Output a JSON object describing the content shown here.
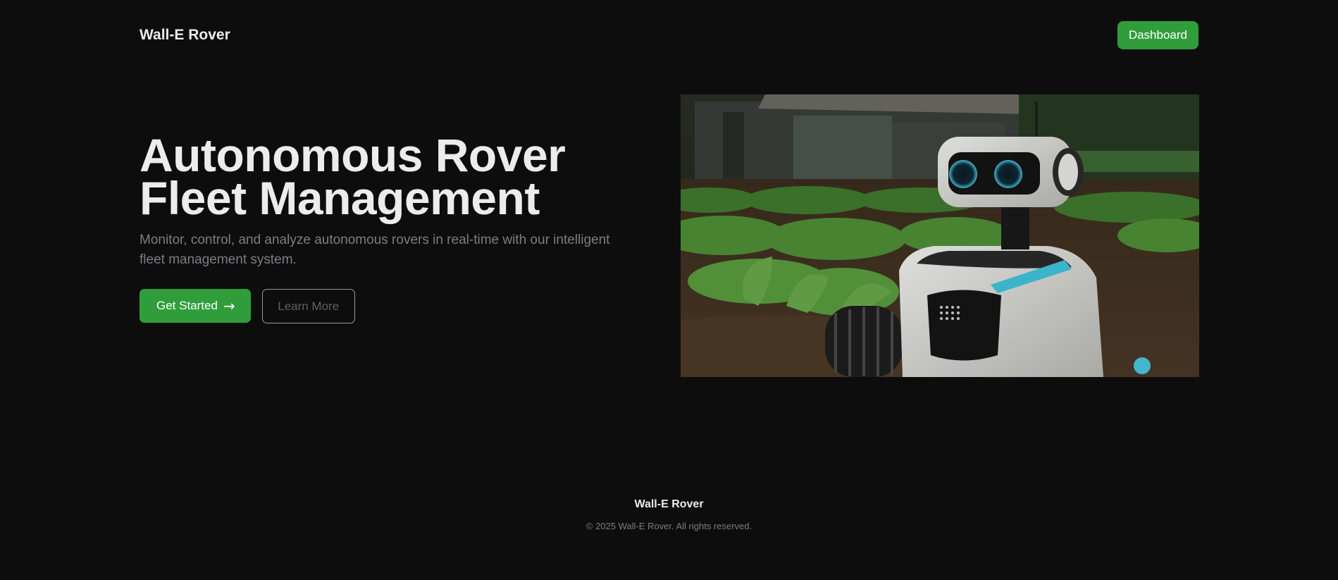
{
  "header": {
    "brand": "Wall-E Rover",
    "dashboard_label": "Dashboard"
  },
  "hero": {
    "title": "Autonomous Rover Fleet Management",
    "subtitle": "Monitor, control, and analyze autonomous rovers in real-time with our intelligent fleet management system.",
    "primary_label": "Get Started",
    "primary_icon": "arrow-right-icon",
    "primary_arrow": "→",
    "secondary_label": "Learn More",
    "image_alt": "Rover robot in a crop field"
  },
  "footer": {
    "brand": "Wall-E Rover",
    "copyright": "© 2025 Wall-E Rover. All rights reserved."
  },
  "colors": {
    "background": "#0d0d0d",
    "accent": "#2f9e3a",
    "text": "#ececec",
    "muted": "#7c7c84"
  }
}
